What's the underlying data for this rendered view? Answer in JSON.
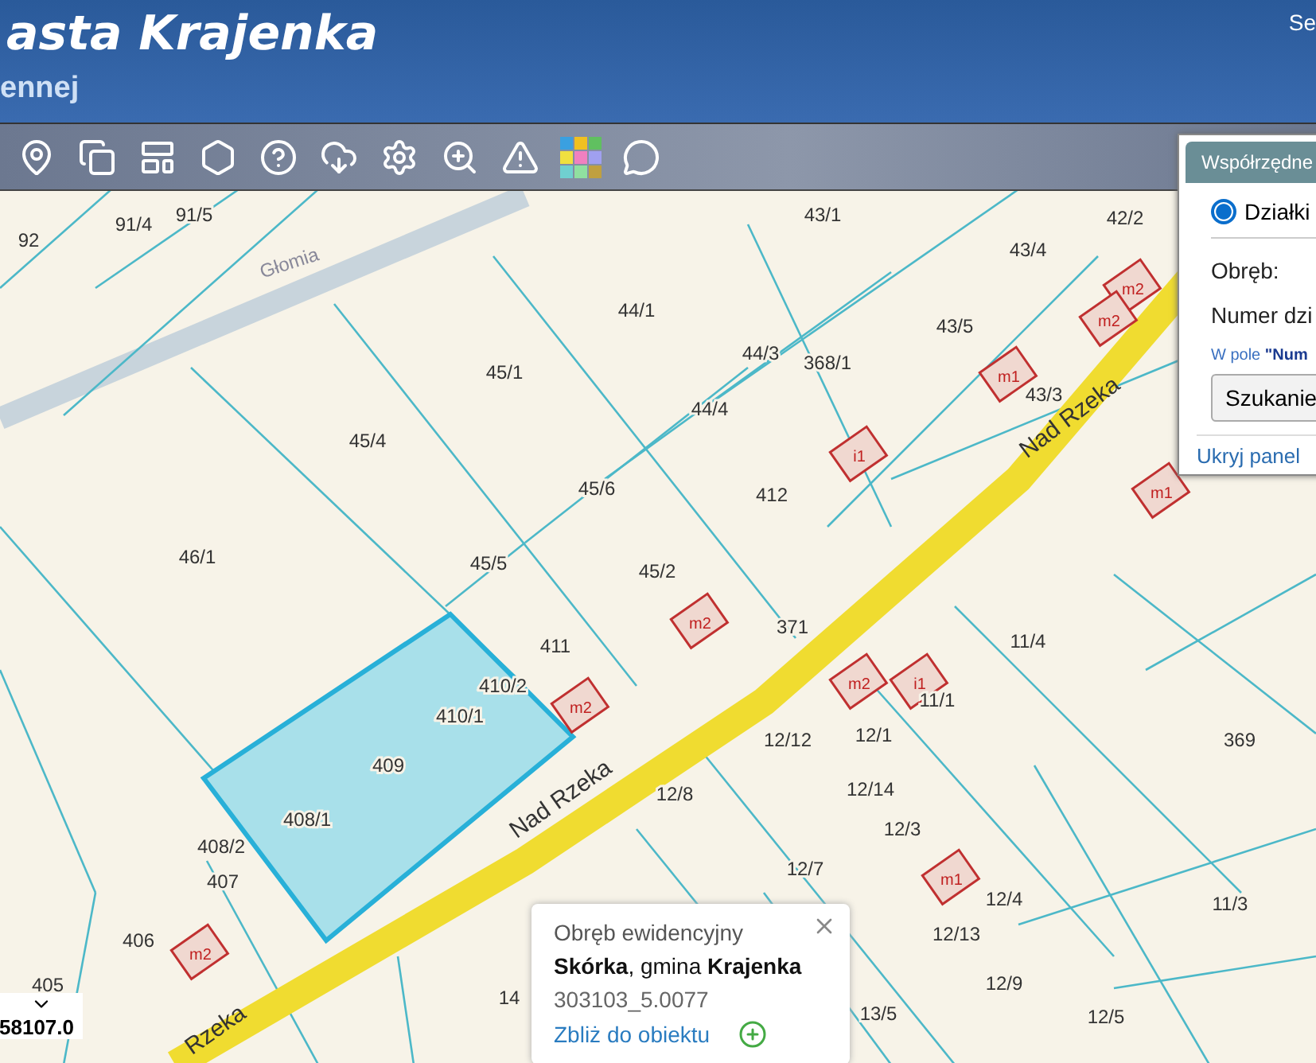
{
  "header": {
    "title": "asta Krajenka",
    "subtitle": "ennej",
    "corner_text": "Se"
  },
  "panel": {
    "tab": "Współrzędne",
    "options": [
      {
        "label": "Działki",
        "selected": true
      }
    ],
    "fields": [
      "Obręb:",
      "Numer dzi"
    ],
    "hint": "W pole **\"Num**",
    "button": "Szukanie",
    "hide_link": "Ukryj panel"
  },
  "map": {
    "streets": [
      "Głomia",
      "Nad Rzeka",
      "Nad Rzeka",
      "Rzeka"
    ],
    "parcels": [
      "92",
      "91/4",
      "91/5",
      "43/1",
      "42/2",
      "43/4",
      "44/1",
      "45/1",
      "44/3",
      "368/1",
      "43/5",
      "43/3",
      "44/4",
      "45/4",
      "45/6",
      "412",
      "46/1",
      "45/5",
      "45/2",
      "371",
      "411",
      "410/2",
      "410/1",
      "11/4",
      "11/1",
      "12/12",
      "12/1",
      "369",
      "409",
      "408/1",
      "408/2",
      "407",
      "12/8",
      "12/14",
      "12/3",
      "12/7",
      "12/4",
      "11/3",
      "406",
      "12/13",
      "12/9",
      "405",
      "14",
      "13/5",
      "12/5"
    ],
    "buildings": [
      "m2",
      "m2",
      "m1",
      "i1",
      "m2",
      "m2",
      "m2",
      "i1",
      "m1",
      "m2",
      "m1"
    ]
  },
  "popup": {
    "heading": "Obręb ewidencyjny",
    "name": "**Skórka**, gmina **Krajenka**",
    "code": "303103_5.0077",
    "zoom_link": "Zbliż do obiektu"
  },
  "coordinate": {
    "value": "58107.0"
  }
}
